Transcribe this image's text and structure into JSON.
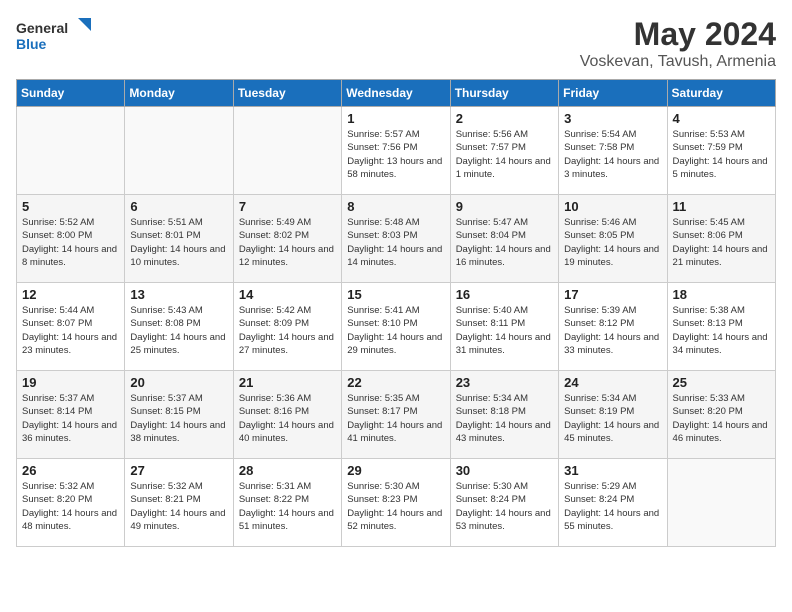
{
  "header": {
    "logo_line1": "General",
    "logo_line2": "Blue",
    "title": "May 2024",
    "subtitle": "Voskevan, Tavush, Armenia"
  },
  "weekdays": [
    "Sunday",
    "Monday",
    "Tuesday",
    "Wednesday",
    "Thursday",
    "Friday",
    "Saturday"
  ],
  "weeks": [
    [
      {
        "day": "",
        "empty": true
      },
      {
        "day": "",
        "empty": true
      },
      {
        "day": "",
        "empty": true
      },
      {
        "day": "1",
        "rise": "5:57 AM",
        "set": "7:56 PM",
        "daylight": "13 hours and 58 minutes."
      },
      {
        "day": "2",
        "rise": "5:56 AM",
        "set": "7:57 PM",
        "daylight": "14 hours and 1 minute."
      },
      {
        "day": "3",
        "rise": "5:54 AM",
        "set": "7:58 PM",
        "daylight": "14 hours and 3 minutes."
      },
      {
        "day": "4",
        "rise": "5:53 AM",
        "set": "7:59 PM",
        "daylight": "14 hours and 5 minutes."
      }
    ],
    [
      {
        "day": "5",
        "rise": "5:52 AM",
        "set": "8:00 PM",
        "daylight": "14 hours and 8 minutes."
      },
      {
        "day": "6",
        "rise": "5:51 AM",
        "set": "8:01 PM",
        "daylight": "14 hours and 10 minutes."
      },
      {
        "day": "7",
        "rise": "5:49 AM",
        "set": "8:02 PM",
        "daylight": "14 hours and 12 minutes."
      },
      {
        "day": "8",
        "rise": "5:48 AM",
        "set": "8:03 PM",
        "daylight": "14 hours and 14 minutes."
      },
      {
        "day": "9",
        "rise": "5:47 AM",
        "set": "8:04 PM",
        "daylight": "14 hours and 16 minutes."
      },
      {
        "day": "10",
        "rise": "5:46 AM",
        "set": "8:05 PM",
        "daylight": "14 hours and 19 minutes."
      },
      {
        "day": "11",
        "rise": "5:45 AM",
        "set": "8:06 PM",
        "daylight": "14 hours and 21 minutes."
      }
    ],
    [
      {
        "day": "12",
        "rise": "5:44 AM",
        "set": "8:07 PM",
        "daylight": "14 hours and 23 minutes."
      },
      {
        "day": "13",
        "rise": "5:43 AM",
        "set": "8:08 PM",
        "daylight": "14 hours and 25 minutes."
      },
      {
        "day": "14",
        "rise": "5:42 AM",
        "set": "8:09 PM",
        "daylight": "14 hours and 27 minutes."
      },
      {
        "day": "15",
        "rise": "5:41 AM",
        "set": "8:10 PM",
        "daylight": "14 hours and 29 minutes."
      },
      {
        "day": "16",
        "rise": "5:40 AM",
        "set": "8:11 PM",
        "daylight": "14 hours and 31 minutes."
      },
      {
        "day": "17",
        "rise": "5:39 AM",
        "set": "8:12 PM",
        "daylight": "14 hours and 33 minutes."
      },
      {
        "day": "18",
        "rise": "5:38 AM",
        "set": "8:13 PM",
        "daylight": "14 hours and 34 minutes."
      }
    ],
    [
      {
        "day": "19",
        "rise": "5:37 AM",
        "set": "8:14 PM",
        "daylight": "14 hours and 36 minutes."
      },
      {
        "day": "20",
        "rise": "5:37 AM",
        "set": "8:15 PM",
        "daylight": "14 hours and 38 minutes."
      },
      {
        "day": "21",
        "rise": "5:36 AM",
        "set": "8:16 PM",
        "daylight": "14 hours and 40 minutes."
      },
      {
        "day": "22",
        "rise": "5:35 AM",
        "set": "8:17 PM",
        "daylight": "14 hours and 41 minutes."
      },
      {
        "day": "23",
        "rise": "5:34 AM",
        "set": "8:18 PM",
        "daylight": "14 hours and 43 minutes."
      },
      {
        "day": "24",
        "rise": "5:34 AM",
        "set": "8:19 PM",
        "daylight": "14 hours and 45 minutes."
      },
      {
        "day": "25",
        "rise": "5:33 AM",
        "set": "8:20 PM",
        "daylight": "14 hours and 46 minutes."
      }
    ],
    [
      {
        "day": "26",
        "rise": "5:32 AM",
        "set": "8:20 PM",
        "daylight": "14 hours and 48 minutes."
      },
      {
        "day": "27",
        "rise": "5:32 AM",
        "set": "8:21 PM",
        "daylight": "14 hours and 49 minutes."
      },
      {
        "day": "28",
        "rise": "5:31 AM",
        "set": "8:22 PM",
        "daylight": "14 hours and 51 minutes."
      },
      {
        "day": "29",
        "rise": "5:30 AM",
        "set": "8:23 PM",
        "daylight": "14 hours and 52 minutes."
      },
      {
        "day": "30",
        "rise": "5:30 AM",
        "set": "8:24 PM",
        "daylight": "14 hours and 53 minutes."
      },
      {
        "day": "31",
        "rise": "5:29 AM",
        "set": "8:24 PM",
        "daylight": "14 hours and 55 minutes."
      },
      {
        "day": "",
        "empty": true
      }
    ]
  ]
}
